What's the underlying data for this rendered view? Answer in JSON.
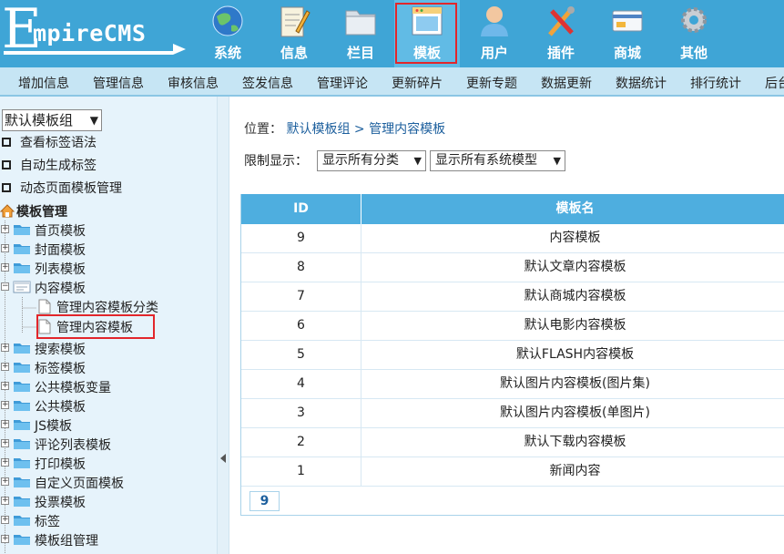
{
  "header": {
    "logo_text": "mpireCMS",
    "logo_letter": "E",
    "nav": [
      {
        "label": "系统",
        "icon": "globe-icon"
      },
      {
        "label": "信息",
        "icon": "notepad-pencil-icon"
      },
      {
        "label": "栏目",
        "icon": "folder-icon"
      },
      {
        "label": "模板",
        "icon": "window-template-icon",
        "active": true
      },
      {
        "label": "用户",
        "icon": "user-icon"
      },
      {
        "label": "插件",
        "icon": "tools-icon"
      },
      {
        "label": "商城",
        "icon": "card-icon"
      },
      {
        "label": "其他",
        "icon": "gear-icon"
      }
    ]
  },
  "submenu": [
    "增加信息",
    "管理信息",
    "审核信息",
    "签发信息",
    "管理评论",
    "更新碎片",
    "更新专题",
    "数据更新",
    "数据统计",
    "排行统计",
    "后台"
  ],
  "sidebar": {
    "group_select": "默认模板组",
    "links": [
      "查看标签语法",
      "自动生成标签",
      "动态页面模板管理"
    ],
    "tree_title": "模板管理",
    "tree": [
      {
        "label": "首页模板",
        "expanded": false
      },
      {
        "label": "封面模板",
        "expanded": false
      },
      {
        "label": "列表模板",
        "expanded": false
      },
      {
        "label": "内容模板",
        "expanded": true,
        "children": [
          "管理内容模板分类",
          "管理内容模板"
        ]
      },
      {
        "label": "搜索模板",
        "expanded": false
      },
      {
        "label": "标签模板",
        "expanded": false
      },
      {
        "label": "公共模板变量",
        "expanded": false
      },
      {
        "label": "公共模板",
        "expanded": false
      },
      {
        "label": "JS模板",
        "expanded": false
      },
      {
        "label": "评论列表模板",
        "expanded": false
      },
      {
        "label": "打印模板",
        "expanded": false
      },
      {
        "label": "自定义页面模板",
        "expanded": false
      },
      {
        "label": "投票模板",
        "expanded": false
      },
      {
        "label": "标签",
        "expanded": false
      },
      {
        "label": "模板组管理",
        "expanded": false
      }
    ]
  },
  "main": {
    "breadcrumb_prefix": "位置：",
    "breadcrumb_path": "默认模板组 > 管理内容模板",
    "filter_label": "限制显示：",
    "filter_category": "显示所有分类",
    "filter_model": "显示所有系统模型",
    "table": {
      "headers": [
        "ID",
        "模板名"
      ],
      "rows": [
        {
          "id": "9",
          "name": "内容模板"
        },
        {
          "id": "8",
          "name": "默认文章内容模板"
        },
        {
          "id": "7",
          "name": "默认商城内容模板"
        },
        {
          "id": "6",
          "name": "默认电影内容模板"
        },
        {
          "id": "5",
          "name": "默认FLASH内容模板"
        },
        {
          "id": "4",
          "name": "默认图片内容模板(图片集)"
        },
        {
          "id": "3",
          "name": "默认图片内容模板(单图片)"
        },
        {
          "id": "2",
          "name": "默认下载内容模板"
        },
        {
          "id": "1",
          "name": "新闻内容"
        }
      ],
      "total": "9"
    }
  },
  "colors": {
    "header_bg": "#3fa5d6",
    "submenu_bg": "#c6e5f4",
    "sidebar_bg": "#e6f3fb",
    "table_head": "#4eaedf",
    "highlight": "#e2262b"
  }
}
